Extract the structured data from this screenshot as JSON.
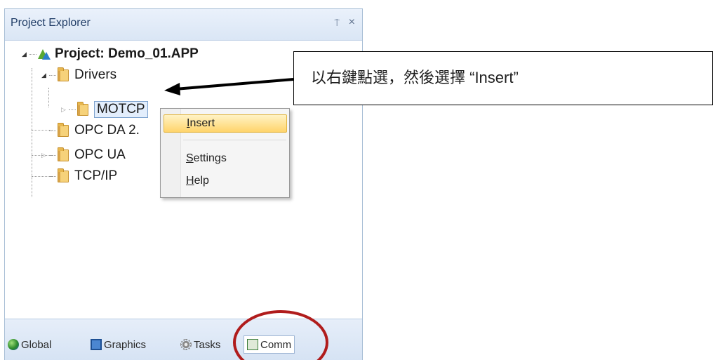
{
  "panel": {
    "title": "Project Explorer",
    "pin_icon": "⍑",
    "close_icon": "×"
  },
  "tree": {
    "project": "Project: Demo_01.APP",
    "drivers": "Drivers",
    "motcp": "MOTCP",
    "opc_da": "OPC DA 2.",
    "opc_ua": "OPC UA",
    "tcpip": "TCP/IP"
  },
  "context_menu": {
    "items": [
      {
        "label": "Insert",
        "mnemonic": "I",
        "active": true
      },
      {
        "label": "Settings",
        "mnemonic": "S",
        "active": false
      },
      {
        "label": "Help",
        "mnemonic": "H",
        "active": false
      }
    ]
  },
  "tabs": [
    {
      "label": "Global",
      "icon": "globe-icon"
    },
    {
      "label": "Graphics",
      "icon": "monitor-icon"
    },
    {
      "label": "Tasks",
      "icon": "gear-icon"
    },
    {
      "label": "Comm",
      "icon": "network-icon",
      "active": true
    }
  ],
  "callout": {
    "text": "以右鍵點選，然後選擇 “Insert”"
  },
  "colors": {
    "highlight_circle": "#b01c1c",
    "menu_hover": "#ffd46b",
    "panel_border": "#a9bfd6"
  }
}
